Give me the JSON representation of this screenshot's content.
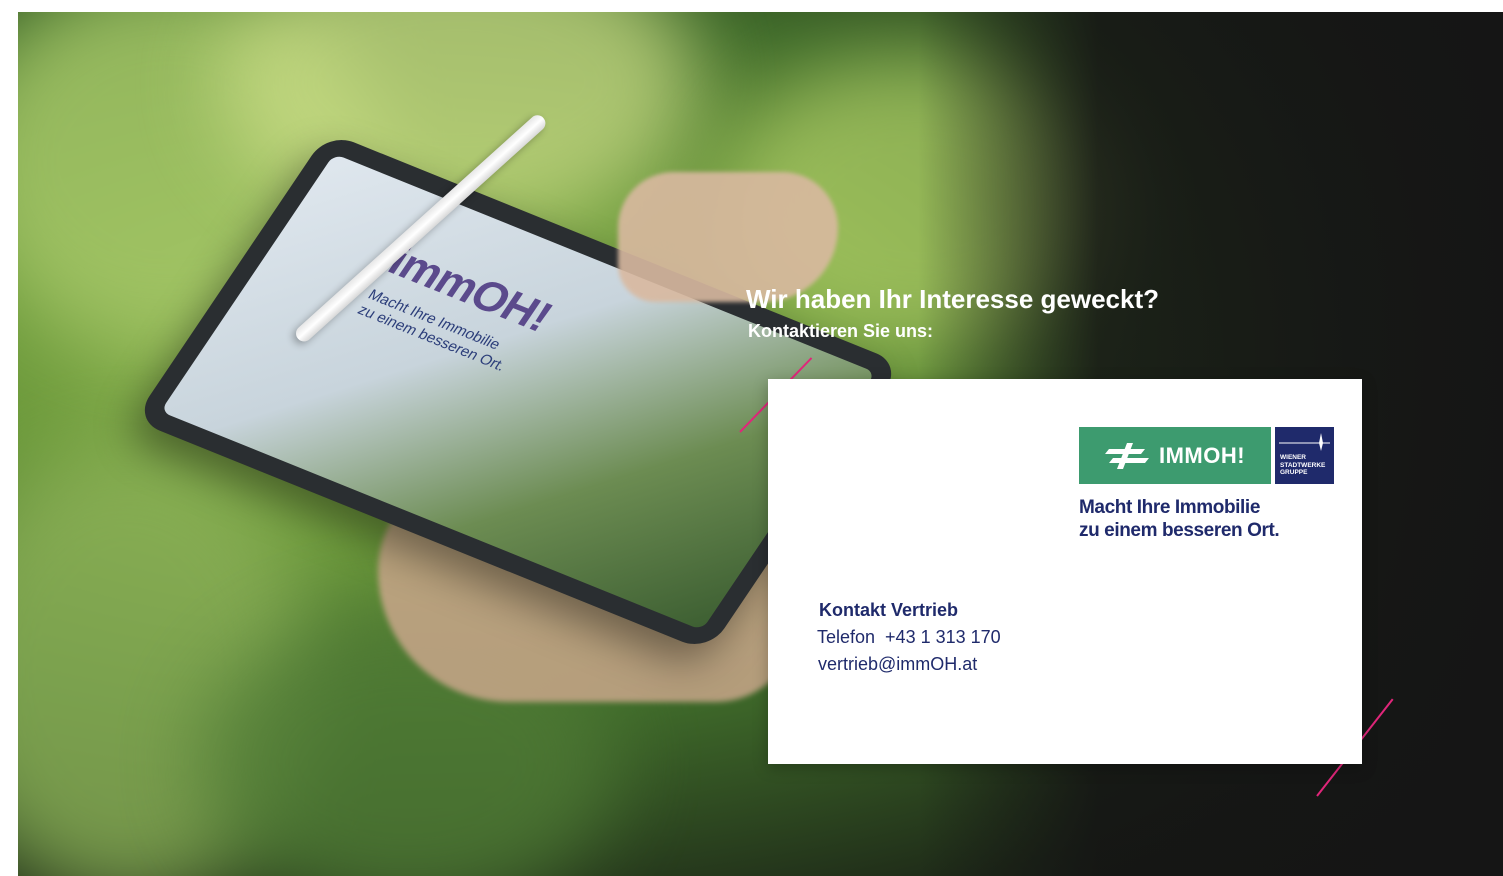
{
  "heading": "Wir haben Ihr Interesse geweckt?",
  "subheading": "Kontaktieren Sie uns:",
  "tablet": {
    "logo_text": "immOH!",
    "tagline_line1": "Macht Ihre Immobilie",
    "tagline_line2": "zu einem besseren Ort."
  },
  "card": {
    "logo": {
      "brand": "IMMOH!",
      "group_line1": "WIENER",
      "group_line2": "STADTWERKE",
      "group_line3": "GRUPPE"
    },
    "tagline_line1": "Macht Ihre Immobilie",
    "tagline_line2": "zu einem besseren Ort.",
    "contact_title": "Kontakt Vertrieb",
    "phone": "Telefon  +43 1 313 170",
    "email": "vertrieb@immOH.at"
  },
  "colors": {
    "accent": "#e0267a",
    "brand_green": "#3d9b6f",
    "brand_navy": "#1f2a6b"
  }
}
